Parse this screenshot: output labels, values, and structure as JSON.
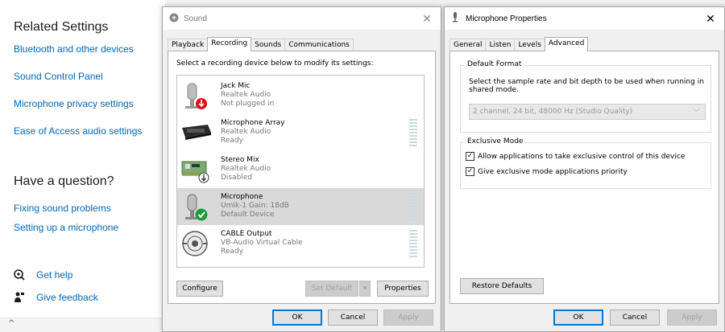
{
  "settings": {
    "related_title": "Related Settings",
    "links": [
      "Bluetooth and other devices",
      "Sound Control Panel",
      "Microphone privacy settings",
      "Ease of Access audio settings"
    ],
    "question_title": "Have a question?",
    "help_links": [
      "Fixing sound problems",
      "Setting up a microphone"
    ],
    "get_help": "Get help",
    "give_feedback": "Give feedback"
  },
  "sound_dialog": {
    "title": "Sound",
    "tabs": [
      "Playback",
      "Recording",
      "Sounds",
      "Communications"
    ],
    "active_tab": "Recording",
    "instruction": "Select a recording device below to modify its settings:",
    "devices": [
      {
        "name": "Jack Mic",
        "line1": "Realtek Audio",
        "line2": "Not plugged in",
        "status_icon": "red-down-arrow-icon"
      },
      {
        "name": "Microphone Array",
        "line1": "Realtek Audio",
        "line2": "Ready",
        "status_icon": ""
      },
      {
        "name": "Stereo Mix",
        "line1": "Realtek Audio",
        "line2": "Disabled",
        "status_icon": "down-arrow-icon"
      },
      {
        "name": "Microphone",
        "line1": "Umik-1  Gain: 18dB",
        "line2": "Default Device",
        "status_icon": "green-check-icon"
      },
      {
        "name": "CABLE Output",
        "line1": "VB-Audio Virtual Cable",
        "line2": "Ready",
        "status_icon": ""
      }
    ],
    "configure": "Configure",
    "set_default": "Set Default",
    "properties": "Properties",
    "ok": "OK",
    "cancel": "Cancel",
    "apply": "Apply"
  },
  "mic_properties": {
    "title": "Microphone Properties",
    "tabs": [
      "General",
      "Listen",
      "Levels",
      "Advanced"
    ],
    "active_tab": "Advanced",
    "default_format_legend": "Default Format",
    "default_format_desc": "Select the sample rate and bit depth to be used when running in shared mode.",
    "format_value": "2 channel, 24 bit, 48000 Hz (Studio Quality)",
    "exclusive_legend": "Exclusive Mode",
    "exclusive_allow": "Allow applications to take exclusive control of this device",
    "exclusive_priority": "Give exclusive mode applications priority",
    "restore_defaults": "Restore Defaults",
    "ok": "OK",
    "cancel": "Cancel",
    "apply": "Apply"
  },
  "colors": {
    "link": "#0067b8",
    "accent": "#0078d7",
    "selected_row": "#d9d9d9"
  }
}
